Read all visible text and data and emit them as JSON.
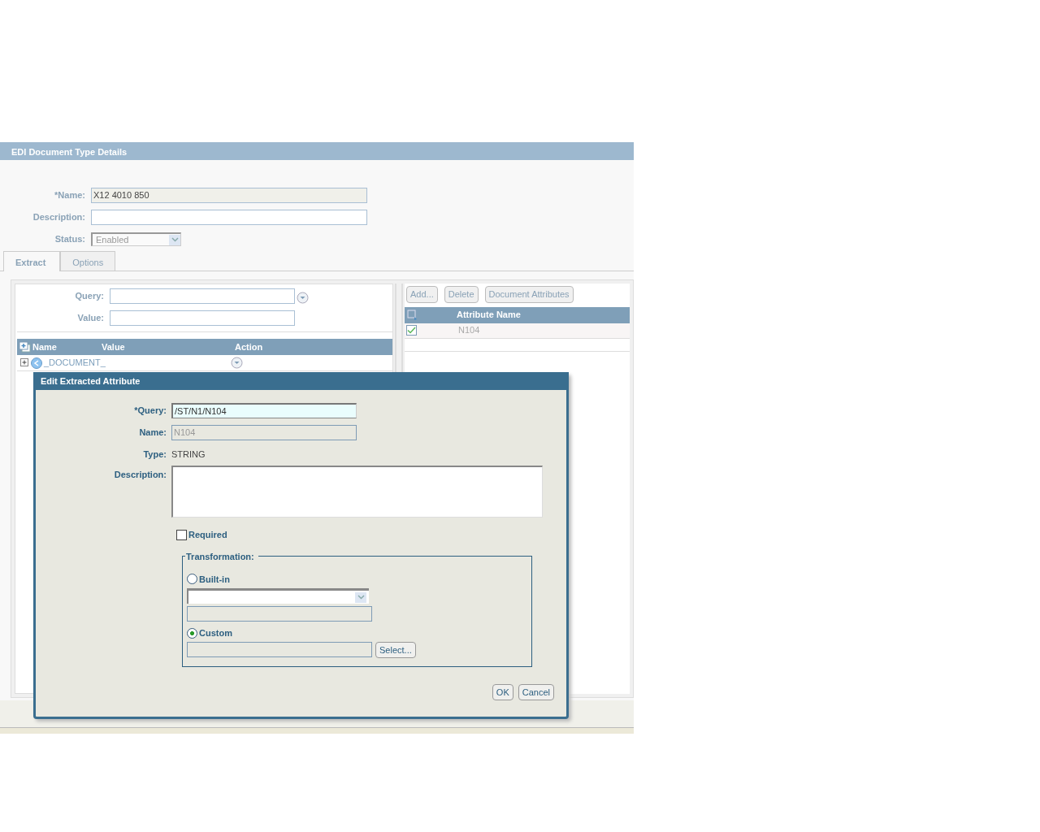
{
  "page_header": {
    "title": "EDI Document Type Details"
  },
  "form": [
    {
      "kind": "text",
      "label": "*Name:",
      "value": "X12 4010 850",
      "disabled": true
    },
    {
      "kind": "text",
      "label": "Description:",
      "disabled": false
    },
    {
      "kind": "select",
      "label": "Status:",
      "value": "Enabled",
      "disabled": true
    }
  ],
  "tabs": [
    {
      "label": "Extract",
      "selected": true
    },
    {
      "label": "Options",
      "selected": false
    }
  ],
  "extract": {
    "fields": [
      {
        "label": "Query:",
        "has_menu": true
      },
      {
        "label": "Value:",
        "has_menu": false
      }
    ],
    "tree": {
      "columns": [
        "Name",
        "Value",
        "Action"
      ],
      "nodes": [
        {
          "label": "_DOCUMENT_",
          "expanded": false
        }
      ]
    }
  },
  "attributes": {
    "buttons": [
      "Add...",
      "Delete",
      "Document Attributes"
    ],
    "column": "Attribute Name",
    "rows": [
      {
        "name": "N104",
        "checked": true
      }
    ]
  },
  "dialog": {
    "title": "Edit Extracted Attribute",
    "fields": [
      {
        "kind": "input",
        "label": "*Query:",
        "value": "/ST/N1/N104",
        "focused": true
      },
      {
        "kind": "input",
        "label": "Name:",
        "value": "N104",
        "disabled": true
      },
      {
        "kind": "static",
        "label": "Type:",
        "value": "STRING"
      },
      {
        "kind": "textarea",
        "label": "Description:"
      }
    ],
    "required": {
      "label": "Required",
      "checked": false
    },
    "transformation": {
      "legend": "Transformation:",
      "options": [
        {
          "kind": "builtin",
          "label": "Built-in",
          "selected": false
        },
        {
          "kind": "custom",
          "label": "Custom",
          "selected": true,
          "button": "Select..."
        }
      ]
    },
    "buttons": [
      "OK",
      "Cancel"
    ]
  }
}
